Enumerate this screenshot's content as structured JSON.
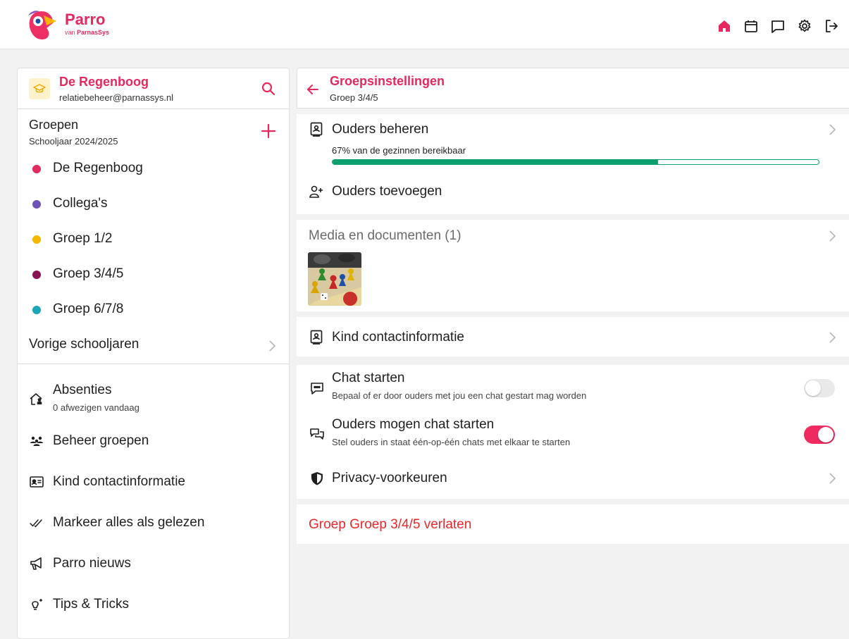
{
  "brand": {
    "name": "Parro",
    "sub_prefix": "van ",
    "sub_brand": "ParnasSys"
  },
  "topnav": {
    "icons": [
      "home-icon",
      "calendar-icon",
      "chat-icon",
      "settings-icon",
      "logout-icon"
    ],
    "active_color": "#e5285e"
  },
  "sidebar": {
    "school": {
      "name": "De Regenboog",
      "email": "relatiebeheer@parnassys.nl"
    },
    "groups": {
      "title": "Groepen",
      "year": "Schooljaar 2024/2025",
      "items": [
        {
          "label": "De Regenboog",
          "color": "#e5285e"
        },
        {
          "label": "Collega's",
          "color": "#6f52b5"
        },
        {
          "label": "Groep 1/2",
          "color": "#f5b800"
        },
        {
          "label": "Groep 3/4/5",
          "color": "#8a1153"
        },
        {
          "label": "Groep 6/7/8",
          "color": "#1aa5b8"
        }
      ],
      "previous_years": "Vorige schooljaren"
    },
    "menu": {
      "absences": {
        "label": "Absenties",
        "sub": "0 afwezigen vandaag"
      },
      "manage_groups": "Beheer groepen",
      "child_contact": "Kind contactinformatie",
      "mark_read": "Markeer alles als gelezen",
      "news": "Parro nieuws",
      "tips": "Tips & Tricks"
    }
  },
  "main": {
    "title": "Groepsinstellingen",
    "subtitle": "Groep 3/4/5",
    "parents": {
      "label": "Ouders beheren",
      "reach_text": "67% van de gezinnen bereikbaar",
      "reach_fraction": 0.67,
      "add_label": "Ouders toevoegen"
    },
    "media": {
      "label": "Media en documenten (1)"
    },
    "child_contact": "Kind contactinformatie",
    "chat_start": {
      "label": "Chat starten",
      "sub": "Bepaal of er door ouders met jou een chat gestart mag worden",
      "enabled": false
    },
    "parents_chat": {
      "label": "Ouders mogen chat starten",
      "sub": "Stel ouders in staat één-op-één chats met elkaar te starten",
      "enabled": true
    },
    "privacy": "Privacy-voorkeuren",
    "leave": "Groep Groep 3/4/5 verlaten"
  }
}
